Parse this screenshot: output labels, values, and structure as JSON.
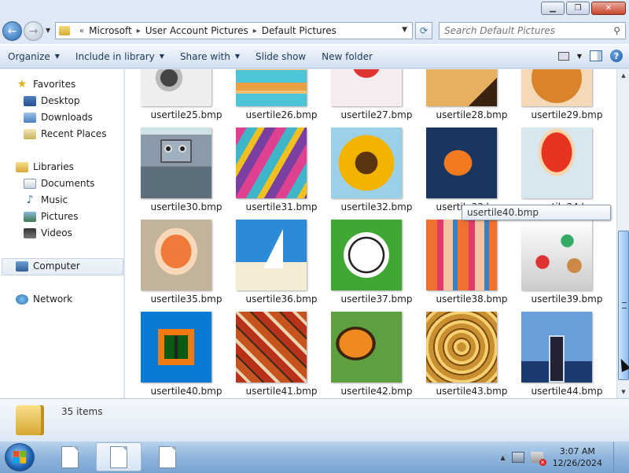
{
  "address": {
    "crumbs": [
      "Microsoft",
      "User Account Pictures",
      "Default Pictures"
    ],
    "chevron": "«"
  },
  "search": {
    "placeholder": "Search Default Pictures"
  },
  "commands": {
    "organize": "Organize",
    "include": "Include in library",
    "share": "Share with",
    "slideshow": "Slide show",
    "newfolder": "New folder"
  },
  "nav": {
    "favorites": "Favorites",
    "desktop": "Desktop",
    "downloads": "Downloads",
    "recent": "Recent Places",
    "libraries": "Libraries",
    "documents": "Documents",
    "music": "Music",
    "pictures": "Pictures",
    "videos": "Videos",
    "computer": "Computer",
    "network": "Network"
  },
  "files": [
    "usertile25.bmp",
    "usertile26.bmp",
    "usertile27.bmp",
    "usertile28.bmp",
    "usertile29.bmp",
    "usertile30.bmp",
    "usertile31.bmp",
    "usertile32.bmp",
    "usertile33.bmp",
    "usertile34.bmp",
    "usertile35.bmp",
    "usertile36.bmp",
    "usertile37.bmp",
    "usertile38.bmp",
    "usertile39.bmp",
    "usertile40.bmp",
    "usertile41.bmp",
    "usertile42.bmp",
    "usertile43.bmp",
    "usertile44.bmp"
  ],
  "tooltip": "usertile40.bmp",
  "details": {
    "count": "35 items"
  },
  "clock": {
    "time": "3:07 AM",
    "date": "12/26/2024"
  },
  "icons": [
    "back-icon",
    "forward-icon",
    "refresh-icon",
    "search-icon",
    "help-icon",
    "windows-logo-icon"
  ]
}
